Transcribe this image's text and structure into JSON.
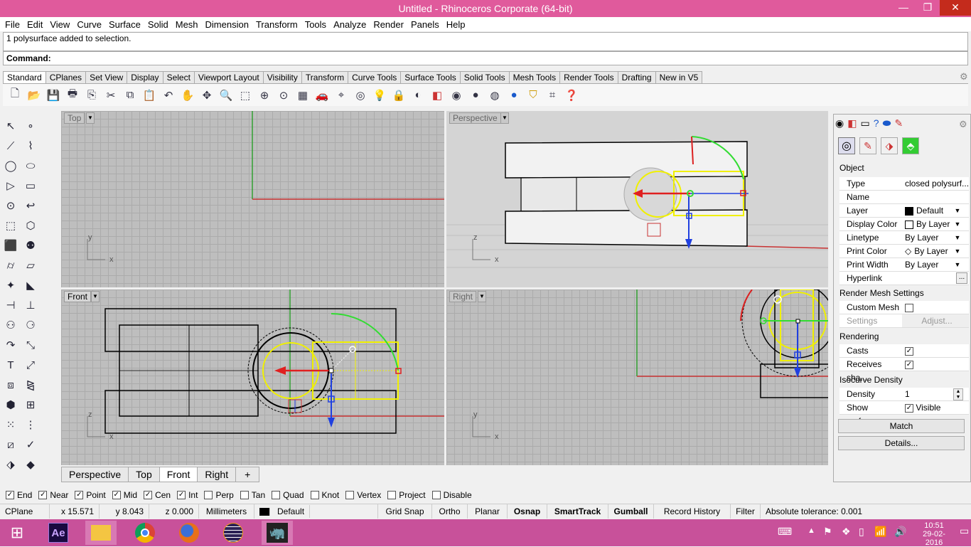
{
  "window": {
    "title": "Untitled - Rhinoceros Corporate (64-bit)",
    "min": "—",
    "restore": "❐",
    "close": "✕"
  },
  "menu": [
    "File",
    "Edit",
    "View",
    "Curve",
    "Surface",
    "Solid",
    "Mesh",
    "Dimension",
    "Transform",
    "Tools",
    "Analyze",
    "Render",
    "Panels",
    "Help"
  ],
  "command": {
    "history": "1 polysurface added to selection.",
    "prompt": "Command:"
  },
  "toolbar_tabs": [
    "Standard",
    "CPlanes",
    "Set View",
    "Display",
    "Select",
    "Viewport Layout",
    "Visibility",
    "Transform",
    "Curve Tools",
    "Surface Tools",
    "Solid Tools",
    "Mesh Tools",
    "Render Tools",
    "Drafting",
    "New in V5"
  ],
  "toolbar_icons": [
    "new-file-icon",
    "open-file-icon",
    "save-icon",
    "print-icon",
    "import-icon",
    "cut-icon",
    "copy-icon",
    "paste-icon",
    "undo-icon",
    "pan-icon",
    "rotate-view-icon",
    "zoom-icon",
    "zoom-window-icon",
    "zoom-extents-icon",
    "zoom-selected-icon",
    "four-viewports-icon",
    "car-icon",
    "cplane-icon",
    "gumball-icon",
    "light-icon",
    "lock-icon",
    "hide-icon",
    "layer-icon",
    "color-icon",
    "shade-icon",
    "rendered-icon",
    "render-icon",
    "filter-icon",
    "osnap-grid-icon",
    "help-icon"
  ],
  "viewports": {
    "top": "Top",
    "perspective": "Perspective",
    "front": "Front",
    "right": "Right"
  },
  "axes": {
    "x": "x",
    "y": "y",
    "z": "z"
  },
  "viewport_tabs": [
    "Perspective",
    "Top",
    "Front",
    "Right",
    "+"
  ],
  "panel": {
    "section_object": "Object",
    "rows": [
      {
        "k": "Type",
        "v": "closed polysurf..."
      },
      {
        "k": "Name",
        "v": ""
      },
      {
        "k": "Layer",
        "v": "Default"
      },
      {
        "k": "Display Color",
        "v": "By Layer"
      },
      {
        "k": "Linetype",
        "v": "By Layer"
      },
      {
        "k": "Print Color",
        "v": "By Layer"
      },
      {
        "k": "Print Width",
        "v": "By Layer"
      },
      {
        "k": "Hyperlink",
        "v": "..."
      }
    ],
    "section_mesh": "Render Mesh Settings",
    "custom_mesh": "Custom Mesh",
    "settings": "Settings",
    "adjust": "Adjust...",
    "section_rendering": "Rendering",
    "casts": "Casts shadows",
    "receives": "Receives sha...",
    "section_isocurve": "Isocurve Density",
    "density_label": "Density",
    "density_value": "1",
    "show_surface": "Show surface...",
    "visible": "Visible",
    "match": "Match",
    "details": "Details..."
  },
  "osnaps": [
    {
      "label": "End",
      "checked": true
    },
    {
      "label": "Near",
      "checked": true
    },
    {
      "label": "Point",
      "checked": true
    },
    {
      "label": "Mid",
      "checked": true
    },
    {
      "label": "Cen",
      "checked": true
    },
    {
      "label": "Int",
      "checked": true
    },
    {
      "label": "Perp",
      "checked": false
    },
    {
      "label": "Tan",
      "checked": false
    },
    {
      "label": "Quad",
      "checked": false
    },
    {
      "label": "Knot",
      "checked": false
    },
    {
      "label": "Vertex",
      "checked": false
    },
    {
      "label": "Project",
      "checked": false
    },
    {
      "label": "Disable",
      "checked": false
    }
  ],
  "status": {
    "cplane": "CPlane",
    "x": "x 15.571",
    "y": "y 8.043",
    "z": "z 0.000",
    "units": "Millimeters",
    "layer": "Default",
    "gridsnap": "Grid Snap",
    "ortho": "Ortho",
    "planar": "Planar",
    "osnap": "Osnap",
    "smarttrack": "SmartTrack",
    "gumball": "Gumball",
    "record": "Record History",
    "filter": "Filter",
    "tolerance": "Absolute tolerance: 0.001"
  },
  "taskbar": {
    "time": "10:51",
    "date": "29-02-2016"
  },
  "colors": {
    "titlebar": "#e05a9c",
    "taskbar": "#c8519a",
    "selection": "#f0f000",
    "xaxis": "#c83232",
    "yaxis": "#32a032"
  }
}
